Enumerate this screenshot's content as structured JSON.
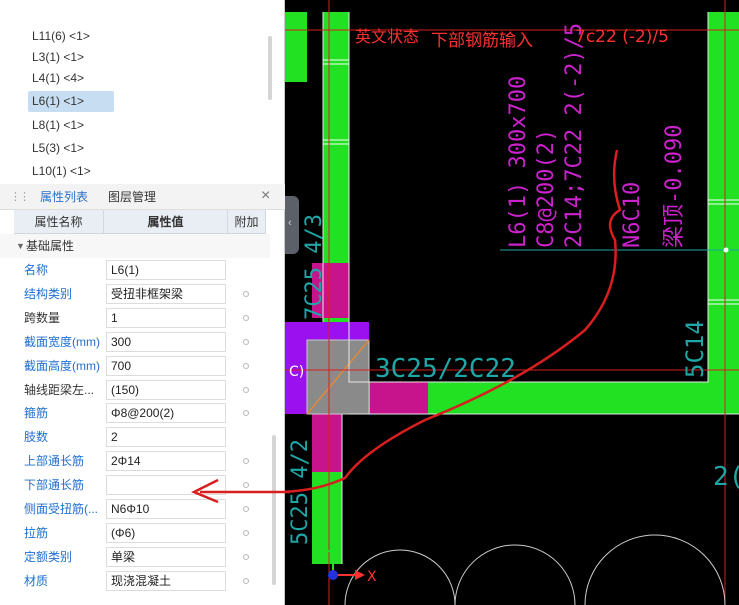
{
  "beam_list": {
    "items": [
      {
        "label": "L11(6) <1>",
        "selected": false
      },
      {
        "label": "L3(1) <1>",
        "selected": false
      },
      {
        "label": "L4(1) <4>",
        "selected": false
      },
      {
        "label": "L6(1) <1>",
        "selected": true
      },
      {
        "label": "L8(1) <1>",
        "selected": false
      },
      {
        "label": "L5(3) <1>",
        "selected": false
      },
      {
        "label": "L10(1) <1>",
        "selected": false
      }
    ]
  },
  "panel_tabs": {
    "properties": "属性列表",
    "layers": "图层管理",
    "close": "×"
  },
  "property_grid": {
    "headers": {
      "name": "属性名称",
      "value": "属性值",
      "extra": "附加"
    },
    "group": "基础属性",
    "rows": [
      {
        "name": "名称",
        "value": "L6(1)",
        "color": "blue",
        "dot": false
      },
      {
        "name": "结构类别",
        "value": "受扭非框架梁",
        "color": "blue",
        "dot": true
      },
      {
        "name": "跨数量",
        "value": "1",
        "color": "dark",
        "dot": true
      },
      {
        "name": "截面宽度(mm)",
        "value": "300",
        "color": "blue",
        "dot": true
      },
      {
        "name": "截面高度(mm)",
        "value": "700",
        "color": "blue",
        "dot": true
      },
      {
        "name": "轴线距梁左...",
        "value": "(150)",
        "color": "dark",
        "dot": true
      },
      {
        "name": "箍筋",
        "value": "Φ8@200(2)",
        "color": "blue",
        "dot": true
      },
      {
        "name": "肢数",
        "value": "2",
        "color": "blue",
        "dot": false
      },
      {
        "name": "上部通长筋",
        "value": "2Φ14",
        "color": "blue",
        "dot": true
      },
      {
        "name": "下部通长筋",
        "value": "",
        "color": "blue",
        "dot": true
      },
      {
        "name": "侧面受扭筋(...",
        "value": "N6Φ10",
        "color": "blue",
        "dot": true
      },
      {
        "name": "拉筋",
        "value": "(Φ6)",
        "color": "blue",
        "dot": true
      },
      {
        "name": "定额类别",
        "value": "单梁",
        "color": "blue",
        "dot": true
      },
      {
        "name": "材质",
        "value": "现浇混凝土",
        "color": "blue",
        "dot": true
      }
    ]
  },
  "canvas": {
    "annotation_state": "英文状态",
    "annotation_input": "下部钢筋输入",
    "annotation_value": "7c22 (-2)/5",
    "beam_label_size": "L6(1) 300x700",
    "beam_label_stirrup": "C8@200(2)",
    "beam_label_rebar": "2C14;7C22 2(-2)/5",
    "beam_label_torsion": "N6C10",
    "beam_label_offset": "梁顶-0.090",
    "rebar_label_horizontal": "3C25/2C22",
    "rebar_label_right": "5C14",
    "rebar_label_left_top": "7C25 4/3",
    "rebar_label_left_bottom": "5C25 4/2",
    "partial_right": "2(",
    "left_marker": "C)",
    "axis_x": "X",
    "colors": {
      "background": "#000000",
      "beam_green": "#22e022",
      "beam_magenta": "#c8148c",
      "column_purple": "#9a10ee",
      "column_grey": "#8a8a8a",
      "label_magenta": "#cc22cc",
      "label_teal": "#1fa6a6",
      "annotation_red": "#ff3030",
      "stroke_red": "#d81e1e"
    }
  }
}
